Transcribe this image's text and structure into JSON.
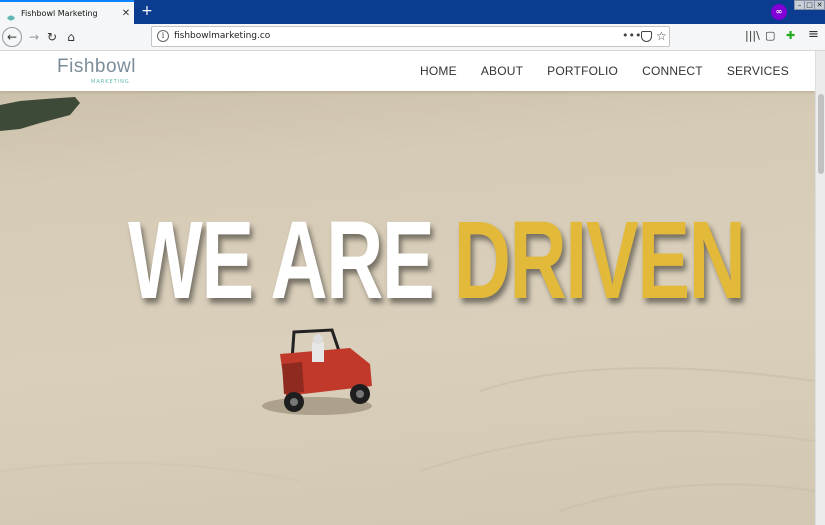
{
  "browser": {
    "tab": {
      "title": "Fishbowl Marketing",
      "close": "✕"
    },
    "new_tab": "+",
    "url": "fishbowlmarketing.co",
    "url_menu": "•••",
    "menu_icon": "≡",
    "icons": [
      "back-icon",
      "forward-icon",
      "reload-icon",
      "home-icon",
      "info-icon",
      "pocket-icon",
      "bookmark-star-icon",
      "library-icon",
      "sidebar-icon",
      "extension-icon",
      "menu-icon",
      "private-browsing-icon"
    ]
  },
  "site": {
    "logo": {
      "main": "Fishbowl",
      "sub": "MARKETING"
    },
    "nav": [
      "HOME",
      "ABOUT",
      "PORTFOLIO",
      "CONNECT",
      "SERVICES"
    ],
    "hero": {
      "headline_part1": "WE ARE ",
      "headline_part2": "DRIVEN"
    }
  },
  "colors": {
    "accent_yellow": "#e3b93a",
    "sand": "#d9cfbb",
    "tab_bar": "#0b3c8f",
    "logo_teal": "#5fb7b1"
  }
}
